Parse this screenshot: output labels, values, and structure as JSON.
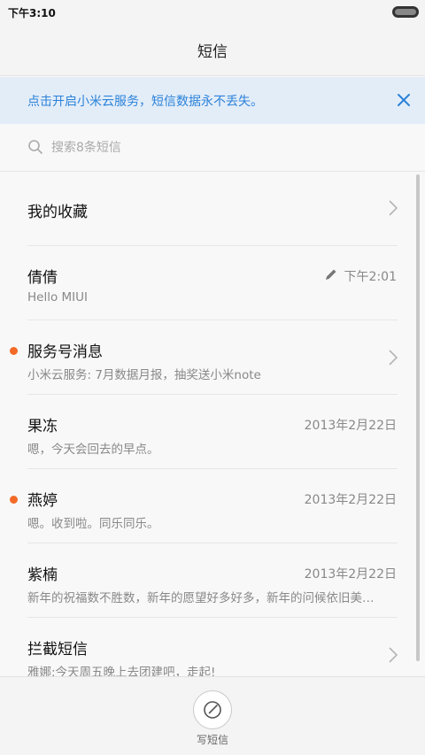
{
  "status_bar": {
    "time": "下午3:10"
  },
  "header": {
    "title": "短信"
  },
  "banner": {
    "text": "点击开启小米云服务，短信数据永不丢失。"
  },
  "search": {
    "placeholder": "搜索8条短信"
  },
  "favorites": {
    "label": "我的收藏"
  },
  "conversations": [
    {
      "name": "倩倩",
      "preview": "Hello MIUI",
      "date": "下午2:01",
      "draft": true
    },
    {
      "name": "服务号消息",
      "preview": "小米云服务: 7月数据月报，抽奖送小米note",
      "date": "",
      "unread": true
    },
    {
      "name": "果冻",
      "preview": "嗯，今天会回去的早点。",
      "date": "2013年2月22日"
    },
    {
      "name": "燕婷",
      "preview": "嗯。收到啦。同乐同乐。",
      "date": "2013年2月22日",
      "unread": true
    },
    {
      "name": "紫楠",
      "preview": "新年的祝福数不胜数，新年的愿望好多好多，新年的问候依旧美…",
      "date": "2013年2月22日"
    },
    {
      "name": "拦截短信",
      "preview": "雅娜:今天周五晚上去团建吧，走起!",
      "date": ""
    }
  ],
  "bottom_bar": {
    "compose_label": "写短信"
  },
  "colors": {
    "accent_blue": "#2b82d9",
    "banner_bg": "#e3edf8",
    "unread_dot": "#f36a27"
  }
}
